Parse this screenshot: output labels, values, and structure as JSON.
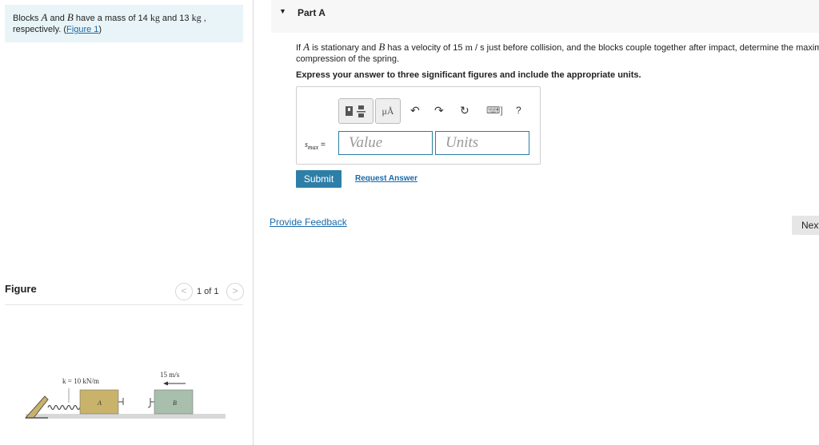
{
  "problem": {
    "pre1": "Blocks ",
    "varA": "A",
    "mid1": " and ",
    "varB": "B",
    "mid2": " have a mass of 14 ",
    "kg1": "kg",
    "mid3": " and 13 ",
    "kg2": "kg",
    "mid4": " ,",
    "line2_pre": "respectively. (",
    "figure_link": "Figure 1",
    "line2_post": ")"
  },
  "figure": {
    "label": "Figure",
    "pager": "1 of 1",
    "prev_glyph": "<",
    "next_glyph": ">",
    "spring_label": "k = 10 kN/m",
    "velocity_label": "15 m/s",
    "block_a": "A",
    "block_b": "B"
  },
  "part": {
    "arrow": "▼",
    "title": "Part A"
  },
  "question": {
    "p1": "If ",
    "varA": "A",
    "p2": " is stationary and ",
    "varB": "B",
    "p3": " has a velocity of 15 ",
    "unit_m": "m",
    "p4": " / s just before collision, and the blocks couple together after impact, determine the maximum",
    "line2": "compression of the spring."
  },
  "instructions": "Express your answer to three significant figures and include the appropriate units.",
  "answer": {
    "mu_label": "μÅ",
    "undo": "↶",
    "redo": "↷",
    "reset": "↻",
    "keyboard": "⌨]",
    "help": "?",
    "var_s": "s",
    "var_sub": "max",
    "equals": " =",
    "value_placeholder": "Value",
    "units_placeholder": "Units"
  },
  "buttons": {
    "submit": "Submit",
    "request": "Request Answer",
    "feedback": "Provide Feedback",
    "next": "Next"
  },
  "colors": {
    "accent": "#2d7fa8",
    "link": "#1a6aa8",
    "problem_bg": "#e8f4f8",
    "block_a": "#c9b26a",
    "block_b": "#a9bfad"
  }
}
